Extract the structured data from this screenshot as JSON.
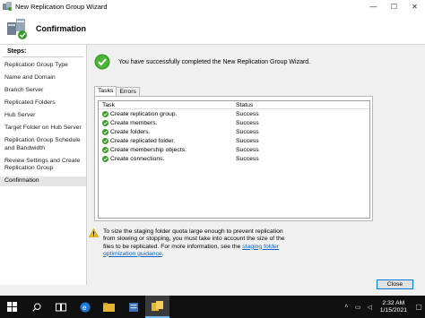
{
  "window": {
    "title": "New Replication Group Wizard",
    "minimize": "—",
    "maximize": "☐",
    "close": "✕"
  },
  "header": {
    "title": "Confirmation"
  },
  "steps": {
    "title": "Steps:",
    "items": [
      "Replication Group Type",
      "Name and Domain",
      "Branch Server",
      "Replicated Folders",
      "Hub Server",
      "Target Folder on Hub Server",
      "Replication Group Schedule and Bandwidth",
      "Review Settings and Create Replication Group",
      "Confirmation"
    ],
    "active_index": 8
  },
  "main": {
    "success_message": "You have successfully completed the New Replication Group Wizard.",
    "tabs": [
      "Tasks",
      "Errors"
    ],
    "selected_tab": 0,
    "grid": {
      "headers": [
        "Task",
        "Status"
      ],
      "rows": [
        {
          "task": "Create replication group.",
          "status": "Success"
        },
        {
          "task": "Create members.",
          "status": "Success"
        },
        {
          "task": "Create folders.",
          "status": "Success"
        },
        {
          "task": "Create replicated folder.",
          "status": "Success"
        },
        {
          "task": "Create membership objects.",
          "status": "Success"
        },
        {
          "task": "Create connections.",
          "status": "Success"
        }
      ]
    },
    "warning": {
      "text": "To size the staging folder quota large enough to prevent replication from slowing or stopping, you must take into account the size of the files to be replicated. For more information, see the",
      "link": "staging folder optimization guidance",
      "end": "."
    },
    "close_label": "Close"
  },
  "taskbar": {
    "clock_time": "2:32 AM",
    "clock_date": "1/15/2021"
  },
  "colors": {
    "accent": "#0078d7",
    "success": "#3a9a2a",
    "link": "#0b63c5"
  }
}
